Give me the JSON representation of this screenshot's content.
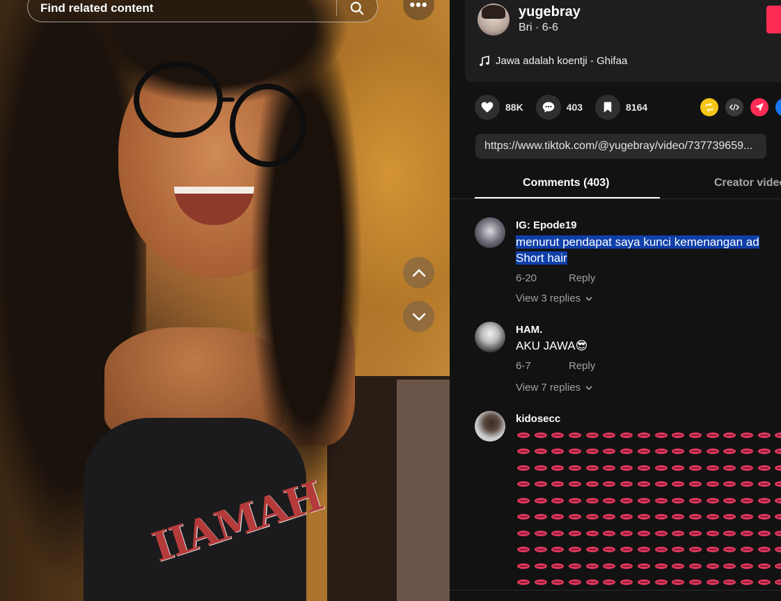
{
  "search": {
    "placeholder": "Find related content"
  },
  "more_glyph": "•••",
  "video": {
    "shirt_text": "IIAMAH"
  },
  "author": {
    "username": "yugebray",
    "subline": "Bri · 6-6",
    "music": "Jawa adalah koentji - Ghifaa"
  },
  "actions": {
    "likes": "88K",
    "comments": "403",
    "saves": "8164"
  },
  "share_icons": [
    {
      "name": "repost-icon",
      "color": "#f5c518"
    },
    {
      "name": "embed-icon",
      "color": "#3a3a3a"
    },
    {
      "name": "send-icon",
      "color": "#fe2c55"
    },
    {
      "name": "more-share-icon",
      "color": "#1877f2"
    }
  ],
  "link": {
    "url": "https://www.tiktok.com/@yugebray/video/737739659..."
  },
  "tabs": {
    "comments": "Comments (403)",
    "creator": "Creator videos"
  },
  "comments": [
    {
      "user": "IG: Epode19",
      "text_line1": "menurut pendapat saya kunci kemenangan ad",
      "text_line2": "Short hair",
      "date": "6-20",
      "reply": "Reply",
      "view_replies": "View 3 replies"
    },
    {
      "user": "HAM.",
      "text_line1": "AKU JAWA",
      "emoji": "😎",
      "date": "6-7",
      "reply": "Reply",
      "view_replies": "View 7 replies"
    },
    {
      "user": "kidosecc",
      "emoji_rows": 10,
      "emoji_per_row": 16,
      "emoji": "lips"
    }
  ],
  "colors": {
    "accent": "#fe2c55",
    "highlight": "#0f3fa8",
    "panel_bg": "#121212"
  }
}
